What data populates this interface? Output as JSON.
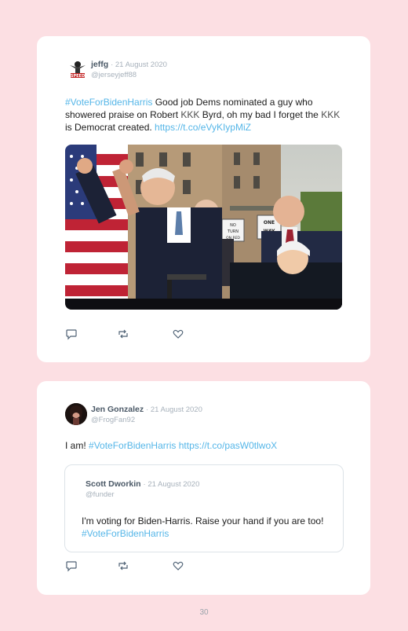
{
  "tweets": [
    {
      "name": "jeffg",
      "date": "· 21 August 2020",
      "handle": "@jerseyjeff88",
      "text_parts": {
        "hashtag": "#VoteForBidenHarris",
        "t1": " Good job Dems nominated a guy who showered praise on Robert ",
        "kkk1": "KKK",
        "t2": " Byrd, oh my bad I forget the ",
        "kkk2": "KKK",
        "t3": " is Democrat created. ",
        "url": "https://t.co/eVyKIypMiZ"
      },
      "avatar_text": "SPEED"
    },
    {
      "name": "Jen Gonzalez",
      "date": "· 21 August 2020",
      "handle": "@FrogFan92",
      "text_parts": {
        "t1": "I am! ",
        "hashtag": "#VoteForBidenHarris",
        "url": " https://t.co/pasW0tlwoX"
      },
      "quote": {
        "name": "Scott Dworkin",
        "date": "· 21 August 2020",
        "handle": "@funder",
        "text": "I'm voting for Biden-Harris. Raise your hand if you are too! ",
        "hashtag": "#VoteForBidenHarris"
      }
    }
  ],
  "photo_signs": {
    "no_turn": "NO TURN ON RED",
    "one_way": "ONE WAY"
  },
  "icons": [
    "reply-icon",
    "retweet-icon",
    "like-icon"
  ],
  "colors": {
    "link": "#55b6e8",
    "background": "#fcdfe3"
  },
  "page_number": "30"
}
